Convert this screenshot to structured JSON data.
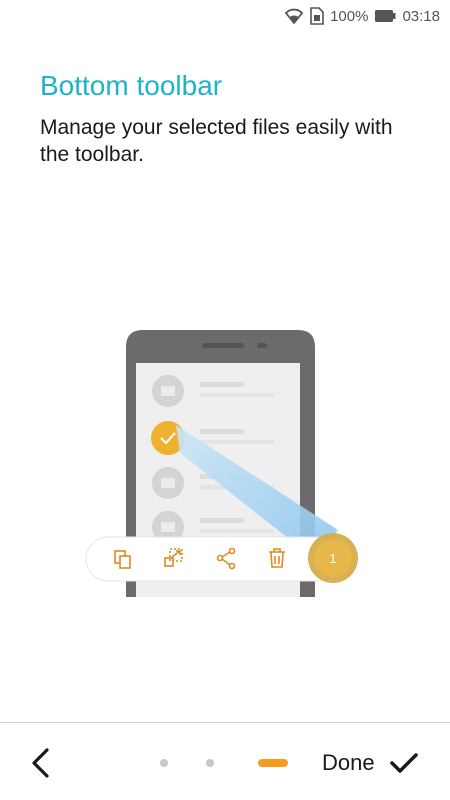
{
  "status_bar": {
    "battery_text": "100%",
    "time": "03:18",
    "icons": [
      "wifi-icon",
      "sim-card-icon",
      "battery-icon"
    ]
  },
  "page": {
    "title": "Bottom toolbar",
    "subtitle": "Manage your selected files easily with the toolbar."
  },
  "illustration": {
    "selected_count": "1",
    "toolbar_icons": [
      "copy-icon",
      "move-icon",
      "share-icon",
      "delete-icon"
    ],
    "accent_color": "#f0b030"
  },
  "navigation": {
    "done_label": "Done",
    "total_pages": 3,
    "current_page": 3,
    "accent_color": "#f39c1f"
  },
  "colors": {
    "title": "#1fb3c6",
    "text": "#1a1a1a"
  }
}
